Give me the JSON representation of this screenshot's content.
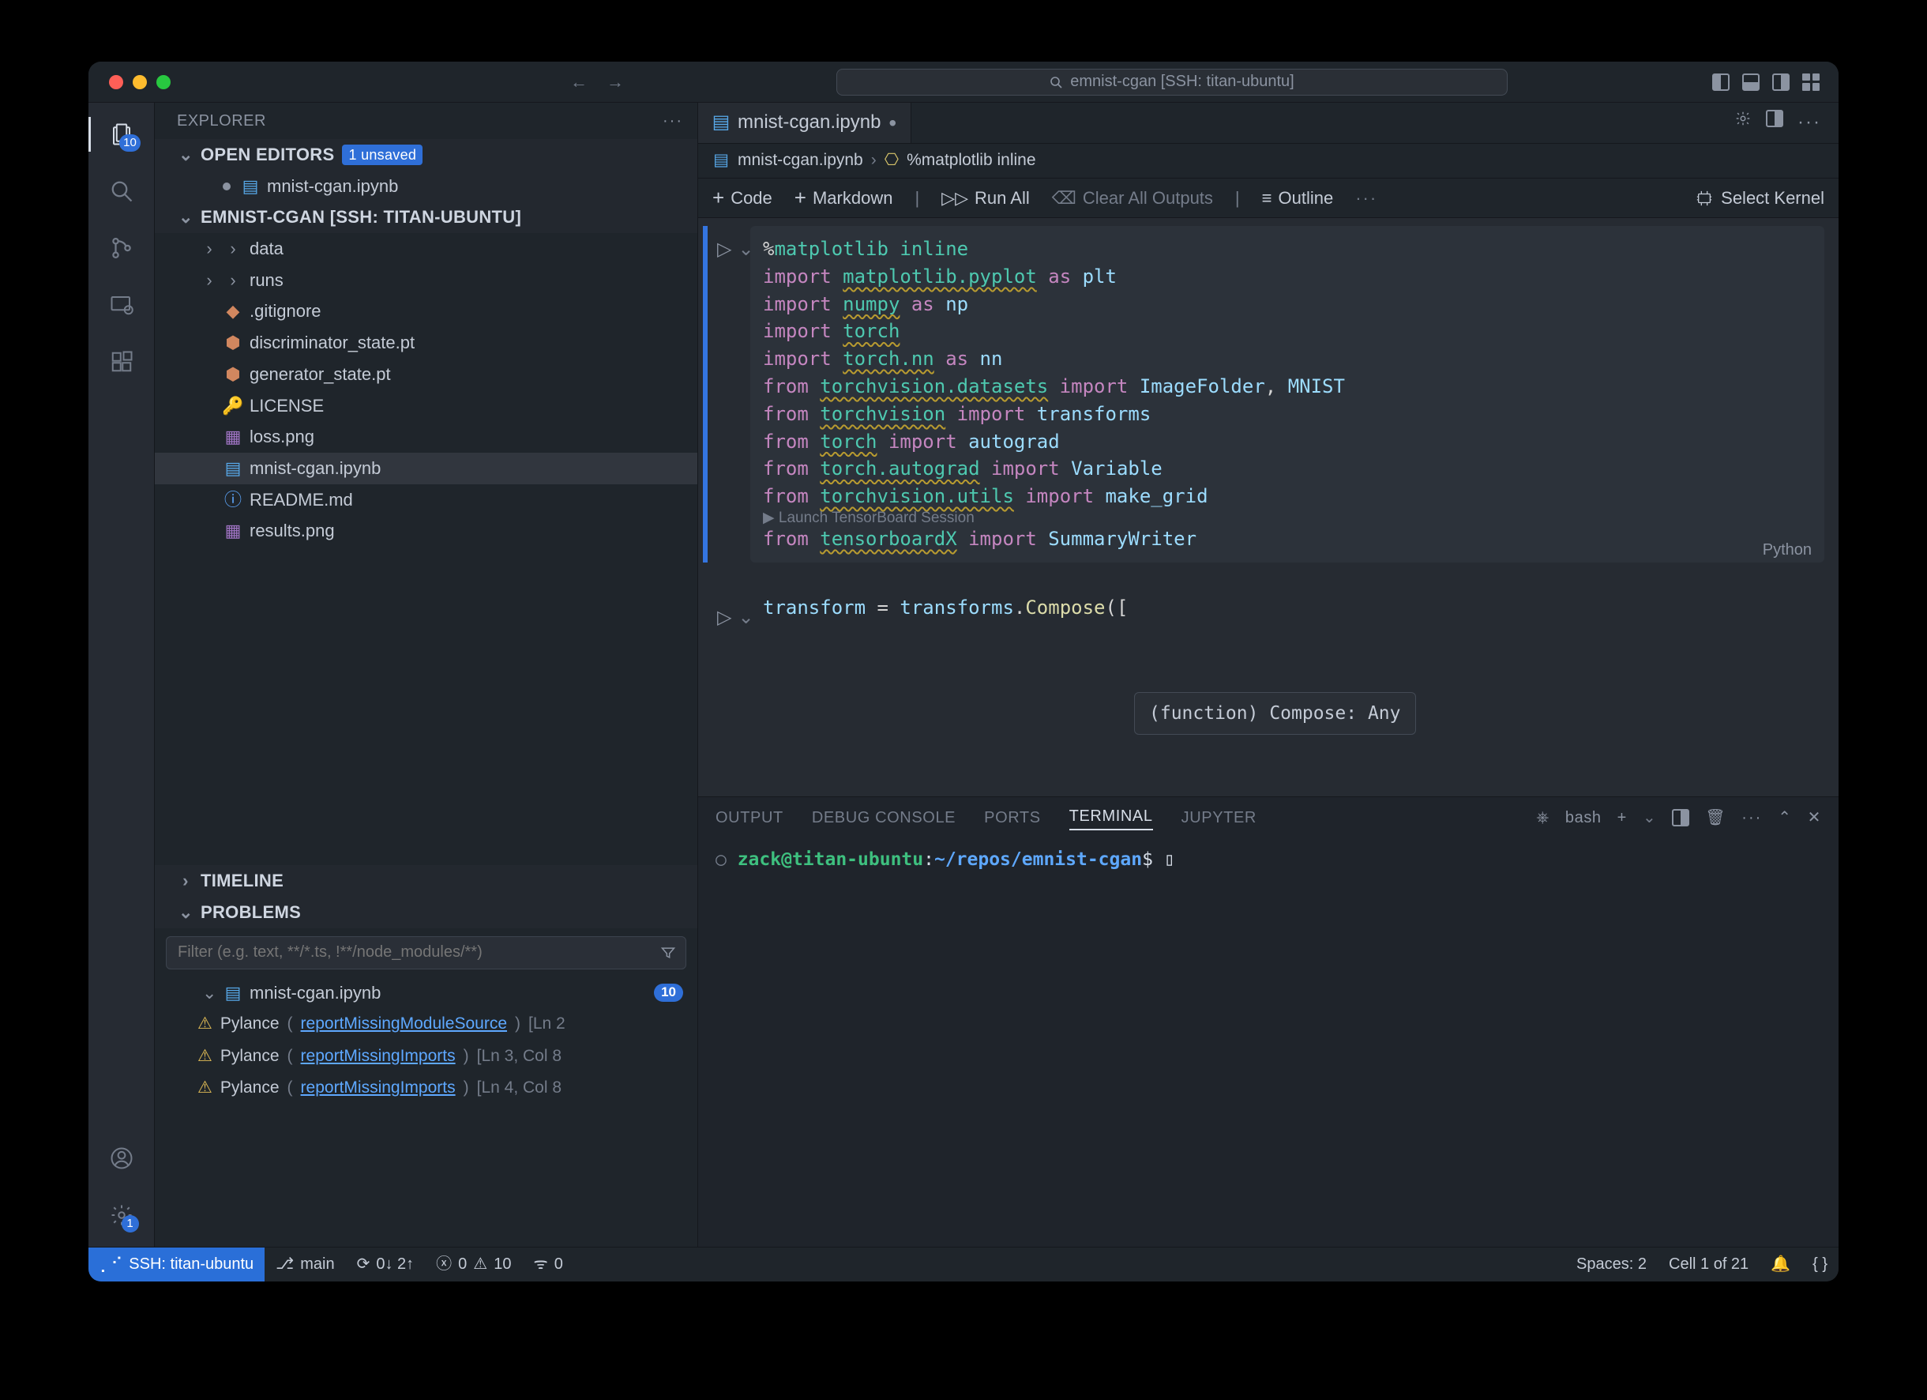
{
  "title": {
    "search_text": "emnist-cgan [SSH: titan-ubuntu]"
  },
  "activity": {
    "explorer_badge": "10",
    "settings_badge": "1"
  },
  "sidebar": {
    "header": "EXPLORER",
    "open_editors": {
      "label": "OPEN EDITORS",
      "pill": "1 unsaved",
      "file": "mnist-cgan.ipynb"
    },
    "project": {
      "label": "EMNIST-CGAN [SSH: TITAN-UBUNTU]",
      "items": [
        {
          "icon": "folder",
          "name": "data"
        },
        {
          "icon": "folder",
          "name": "runs"
        },
        {
          "icon": "git",
          "name": ".gitignore"
        },
        {
          "icon": "pt",
          "name": "discriminator_state.pt"
        },
        {
          "icon": "pt",
          "name": "generator_state.pt"
        },
        {
          "icon": "lic",
          "name": "LICENSE"
        },
        {
          "icon": "img",
          "name": "loss.png"
        },
        {
          "icon": "nb",
          "name": "mnist-cgan.ipynb"
        },
        {
          "icon": "md",
          "name": "README.md"
        },
        {
          "icon": "img",
          "name": "results.png"
        }
      ]
    },
    "timeline": "TIMELINE",
    "problems": {
      "label": "PROBLEMS",
      "filter_placeholder": "Filter (e.g. text, **/*.ts, !**/node_modules/**)",
      "file": "mnist-cgan.ipynb",
      "count": "10",
      "items": [
        {
          "src": "Pylance",
          "rule": "reportMissingModuleSource",
          "loc": "[Ln 2"
        },
        {
          "src": "Pylance",
          "rule": "reportMissingImports",
          "loc": "[Ln 3, Col 8"
        },
        {
          "src": "Pylance",
          "rule": "reportMissingImports",
          "loc": "[Ln 4, Col 8"
        }
      ]
    }
  },
  "editor": {
    "tab": "mnist-cgan.ipynb",
    "crumbs": {
      "file": "mnist-cgan.ipynb",
      "cell": "%matplotlib inline"
    },
    "toolbar": {
      "code": "Code",
      "markdown": "Markdown",
      "run_all": "Run All",
      "clear": "Clear All Outputs",
      "outline": "Outline",
      "kernel": "Select Kernel"
    },
    "cell1": {
      "lines": [
        [
          {
            "t": "%",
            "c": "op"
          },
          {
            "t": "matplotlib inline",
            "c": "mdp"
          }
        ],
        [
          {
            "t": "import ",
            "c": "kwp"
          },
          {
            "t": "matplotlib.pyplot",
            "c": "md"
          },
          {
            "t": " as ",
            "c": "kwp"
          },
          {
            "t": "plt",
            "c": "idn"
          }
        ],
        [
          {
            "t": "import ",
            "c": "kwp"
          },
          {
            "t": "numpy",
            "c": "md"
          },
          {
            "t": " as ",
            "c": "kwp"
          },
          {
            "t": "np",
            "c": "idn"
          }
        ],
        [
          {
            "t": "import ",
            "c": "kwp"
          },
          {
            "t": "torch",
            "c": "md"
          }
        ],
        [
          {
            "t": "import ",
            "c": "kwp"
          },
          {
            "t": "torch.nn",
            "c": "md"
          },
          {
            "t": " as ",
            "c": "kwp"
          },
          {
            "t": "nn",
            "c": "idn"
          }
        ],
        [
          {
            "t": "from ",
            "c": "kwp"
          },
          {
            "t": "torchvision.datasets",
            "c": "md"
          },
          {
            "t": " import ",
            "c": "kwp"
          },
          {
            "t": "ImageFolder",
            "c": "cm"
          },
          {
            "t": ", ",
            "c": "op"
          },
          {
            "t": "MNIST",
            "c": "cm"
          }
        ],
        [
          {
            "t": "from ",
            "c": "kwp"
          },
          {
            "t": "torchvision",
            "c": "md"
          },
          {
            "t": " import ",
            "c": "kwp"
          },
          {
            "t": "transforms",
            "c": "idn"
          }
        ],
        [
          {
            "t": "from ",
            "c": "kwp"
          },
          {
            "t": "torch",
            "c": "md"
          },
          {
            "t": " import ",
            "c": "kwp"
          },
          {
            "t": "autograd",
            "c": "cm"
          }
        ],
        [
          {
            "t": "from ",
            "c": "kwp"
          },
          {
            "t": "torch.autograd",
            "c": "md"
          },
          {
            "t": " import ",
            "c": "kwp"
          },
          {
            "t": "Variable",
            "c": "cm"
          }
        ],
        [
          {
            "t": "from ",
            "c": "kwp"
          },
          {
            "t": "torchvision.utils",
            "c": "md"
          },
          {
            "t": " import ",
            "c": "kwp"
          },
          {
            "t": "make_grid",
            "c": "idn"
          }
        ]
      ],
      "lens": "▶ Launch TensorBoard Session",
      "last": [
        {
          "t": "from ",
          "c": "kwp"
        },
        {
          "t": "tensorboardX",
          "c": "md"
        },
        {
          "t": " import ",
          "c": "kwp"
        },
        {
          "t": "SummaryWriter",
          "c": "cm"
        }
      ],
      "lang": "Python"
    },
    "cell2": {
      "line": [
        {
          "t": "transform ",
          "c": "idn"
        },
        {
          "t": "= ",
          "c": "op"
        },
        {
          "t": "transforms",
          "c": "idn"
        },
        {
          "t": ".",
          "c": "op"
        },
        {
          "t": "Compose",
          "c": "fn"
        },
        {
          "t": "(",
          "c": "op"
        },
        {
          "t": "[",
          "c": "op"
        }
      ]
    },
    "tooltip": "(function) Compose: Any"
  },
  "panel": {
    "tabs": {
      "output": "OUTPUT",
      "debug": "DEBUG CONSOLE",
      "ports": "PORTS",
      "terminal": "TERMINAL",
      "jupyter": "JUPYTER"
    },
    "shell": "bash",
    "term": {
      "user": "zack@titan-ubuntu",
      "sep": ":",
      "path": "~/repos/emnist-cgan",
      "prompt": "$"
    }
  },
  "status": {
    "ssh": "SSH: titan-ubuntu",
    "branch": "main",
    "sync": "0↓ 2↑",
    "errors": "0",
    "warnings": "10",
    "radio": "0",
    "spaces": "Spaces: 2",
    "cell": "Cell 1 of 21"
  }
}
